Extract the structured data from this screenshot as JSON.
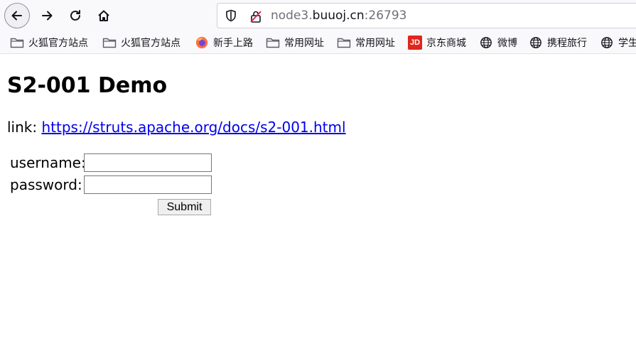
{
  "browser": {
    "url_prefix": "node3.",
    "url_domain": "buuoj.cn",
    "url_port": ":26793",
    "bookmarks": [
      {
        "label": "火狐官方站点",
        "icon": "folder-icon"
      },
      {
        "label": "火狐官方站点",
        "icon": "folder-icon"
      },
      {
        "label": "新手上路",
        "icon": "firefox-icon"
      },
      {
        "label": "常用网址",
        "icon": "folder-icon"
      },
      {
        "label": "常用网址",
        "icon": "folder-icon"
      },
      {
        "label": "京东商城",
        "icon": "jd-icon",
        "icon_text": "JD"
      },
      {
        "label": "微博",
        "icon": "globe-icon"
      },
      {
        "label": "携程旅行",
        "icon": "globe-icon"
      },
      {
        "label": "学生",
        "icon": "globe-icon"
      }
    ]
  },
  "page": {
    "title": "S2-001 Demo",
    "link_prefix": "link: ",
    "link_text": "https://struts.apache.org/docs/s2-001.html",
    "form": {
      "username_label": "username:",
      "password_label": "password:",
      "username_value": "",
      "password_value": "",
      "submit_label": "Submit"
    }
  }
}
